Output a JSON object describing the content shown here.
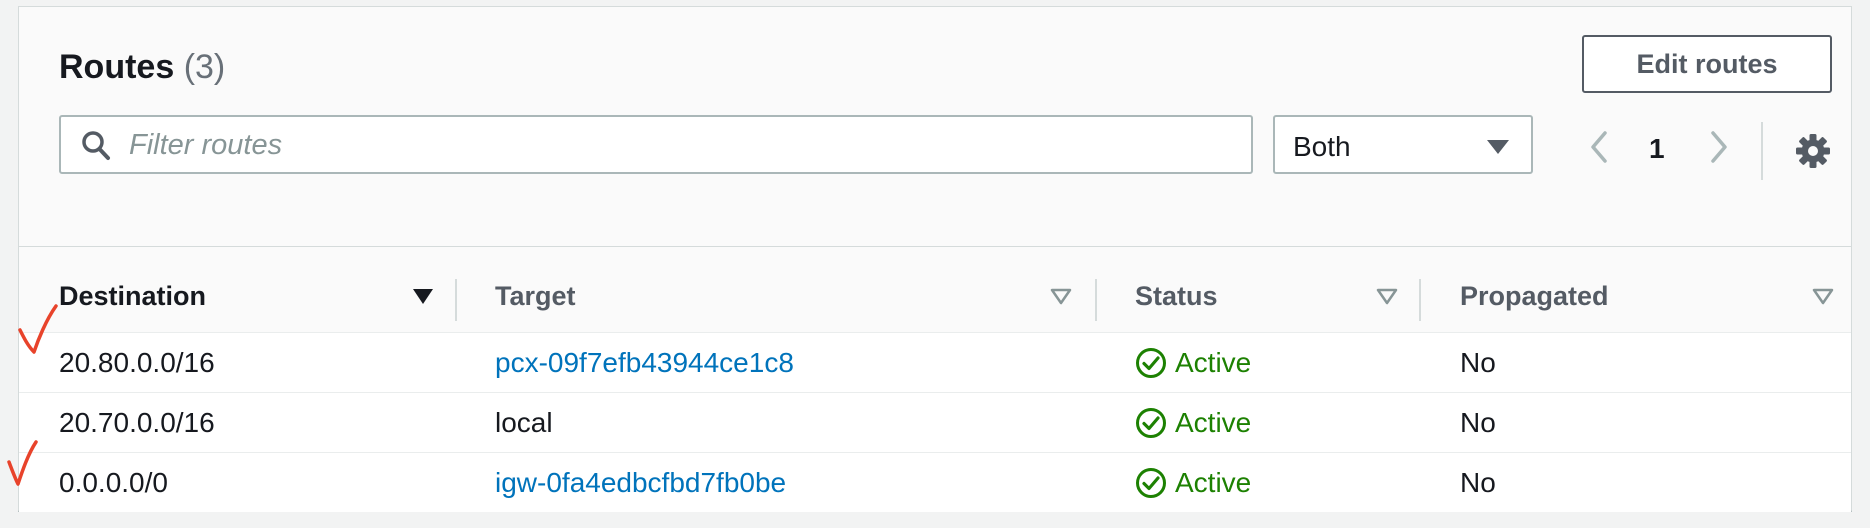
{
  "header": {
    "title": "Routes",
    "count": "(3)",
    "edit_label": "Edit routes"
  },
  "filter": {
    "placeholder": "Filter routes",
    "value": ""
  },
  "select": {
    "value": "Both"
  },
  "pager": {
    "page": "1"
  },
  "columns": [
    {
      "label": "Destination",
      "sorted": true
    },
    {
      "label": "Target",
      "sorted": false
    },
    {
      "label": "Status",
      "sorted": false
    },
    {
      "label": "Propagated",
      "sorted": false
    }
  ],
  "rows": [
    {
      "destination": "20.80.0.0/16",
      "target": "pcx-09f7efb43944ce1c8",
      "target_is_link": true,
      "status": "Active",
      "propagated": "No",
      "checked": true
    },
    {
      "destination": "20.70.0.0/16",
      "target": "local",
      "target_is_link": false,
      "status": "Active",
      "propagated": "No",
      "checked": false
    },
    {
      "destination": "0.0.0.0/0",
      "target": "igw-0fa4edbcfbd7fb0be",
      "target_is_link": true,
      "status": "Active",
      "propagated": "No",
      "checked": true
    }
  ],
  "colors": {
    "link": "#0073bb",
    "status_active": "#1d8102",
    "annotation": "#e8432b"
  },
  "icons": {
    "search": "search-icon",
    "caret": "caret-down-icon",
    "prev": "chevron-left-icon",
    "next": "chevron-right-icon",
    "settings": "gear-icon",
    "status": "status-check-circle-icon",
    "annotation": "handwritten-check-mark-icon"
  }
}
